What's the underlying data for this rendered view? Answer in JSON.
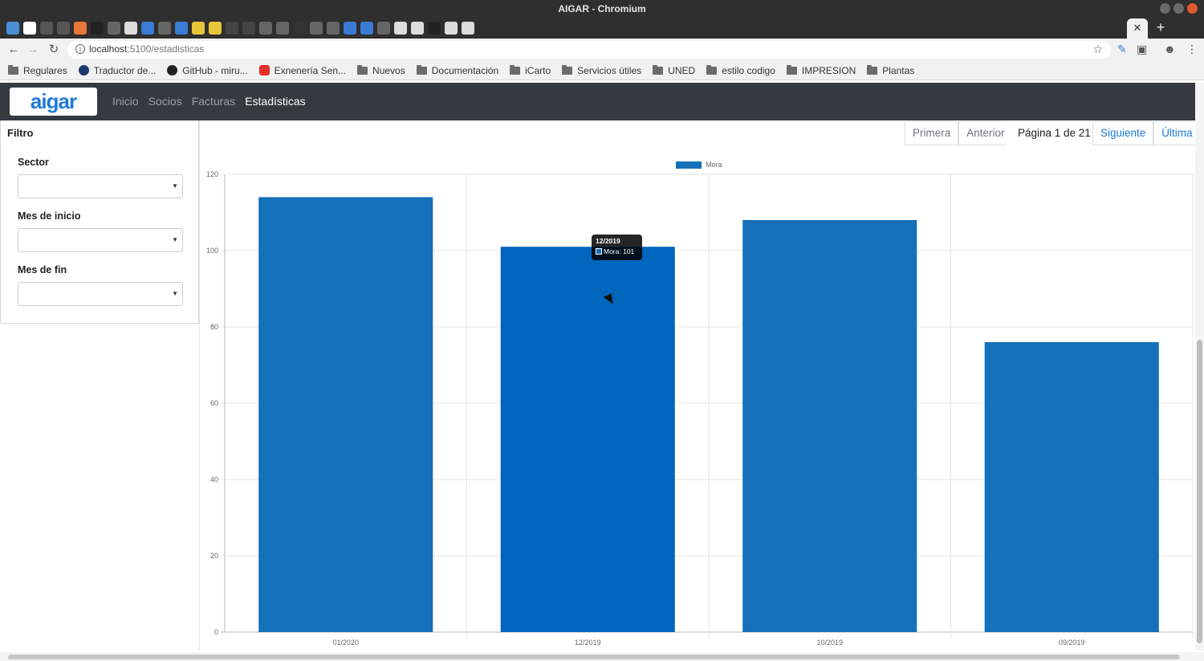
{
  "window": {
    "title": "AIGAR - Chromium"
  },
  "browser": {
    "tab_close": "✕",
    "new_tab": "+",
    "url_host": "localhost",
    "url_rest": ":5100/estadisticas",
    "bookmarks": [
      "Regulares",
      "Traductor de...",
      "GitHub - miru...",
      "Exnenería Sen...",
      "Nuevos",
      "Documentación",
      "iCarto",
      "Servicios útiles",
      "UNED",
      "estilo codigo",
      "IMPRESION",
      "Plantas"
    ]
  },
  "app": {
    "logo": "aigar",
    "nav": {
      "inicio": "Inicio",
      "socios": "Socios",
      "facturas": "Facturas",
      "estadisticas": "Estadísticas"
    }
  },
  "filter": {
    "title": "Filtro",
    "sector_label": "Sector",
    "mes_inicio_label": "Mes de inicio",
    "mes_fin_label": "Mes de fin",
    "sector_value": "",
    "mes_inicio_value": "",
    "mes_fin_value": ""
  },
  "pagination": {
    "first": "Primera",
    "prev": "Anterior",
    "page_info": "Página 1 de 21",
    "next": "Siguiente",
    "last": "Última"
  },
  "tooltip": {
    "title": "12/2019",
    "label": "Mora: 101"
  },
  "colors": {
    "bar": "#1470b8",
    "navbar": "#343a40",
    "link": "#1a79d6"
  },
  "chart_data": {
    "type": "bar",
    "categories": [
      "01/2020",
      "12/2019",
      "10/2019",
      "09/2019"
    ],
    "series": [
      {
        "name": "Mora",
        "values": [
          114,
          101,
          108,
          76
        ]
      }
    ],
    "ylim": [
      0,
      120
    ],
    "yticks": [
      0,
      20,
      40,
      60,
      80,
      100,
      120
    ],
    "grid": true,
    "legend": "top"
  }
}
